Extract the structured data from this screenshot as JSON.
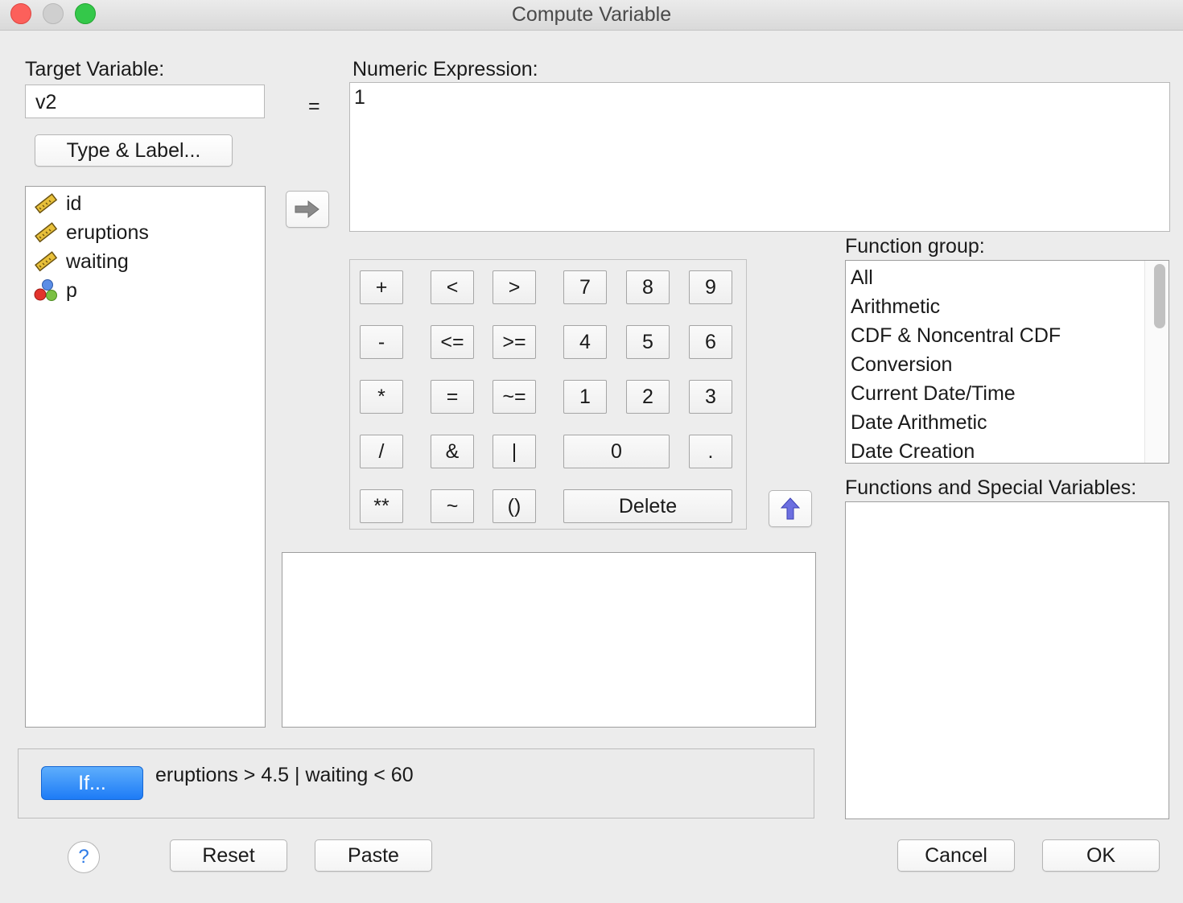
{
  "window": {
    "title": "Compute Variable"
  },
  "target": {
    "label": "Target Variable:",
    "value": "v2",
    "equals": "=",
    "type_label_button": "Type & Label..."
  },
  "expression": {
    "label": "Numeric Expression:",
    "value": "1"
  },
  "variables": [
    {
      "name": "id",
      "icon": "scale-ruler-icon"
    },
    {
      "name": "eruptions",
      "icon": "scale-ruler-icon"
    },
    {
      "name": "waiting",
      "icon": "scale-ruler-icon"
    },
    {
      "name": "p",
      "icon": "nominal-balls-icon"
    }
  ],
  "keypad": {
    "row1": [
      "+",
      "<",
      ">",
      "7",
      "8",
      "9"
    ],
    "row2": [
      "-",
      "<=",
      ">=",
      "4",
      "5",
      "6"
    ],
    "row3": [
      "*",
      "=",
      "~=",
      "1",
      "2",
      "3"
    ],
    "row4": [
      "/",
      "&",
      "|",
      "0",
      "."
    ],
    "row5": [
      "**",
      "~",
      "()",
      "Delete"
    ]
  },
  "function_group": {
    "label": "Function group:",
    "items": [
      "All",
      "Arithmetic",
      "CDF & Noncentral CDF",
      "Conversion",
      "Current Date/Time",
      "Date Arithmetic",
      "Date Creation"
    ]
  },
  "functions": {
    "label": "Functions and Special Variables:"
  },
  "if_panel": {
    "button": "If...",
    "condition": "eruptions > 4.5 | waiting < 60"
  },
  "buttons": {
    "help": "?",
    "reset": "Reset",
    "paste": "Paste",
    "cancel": "Cancel",
    "ok": "OK"
  },
  "colors": {
    "accent": "#1d7bf6",
    "background": "#ececec"
  }
}
